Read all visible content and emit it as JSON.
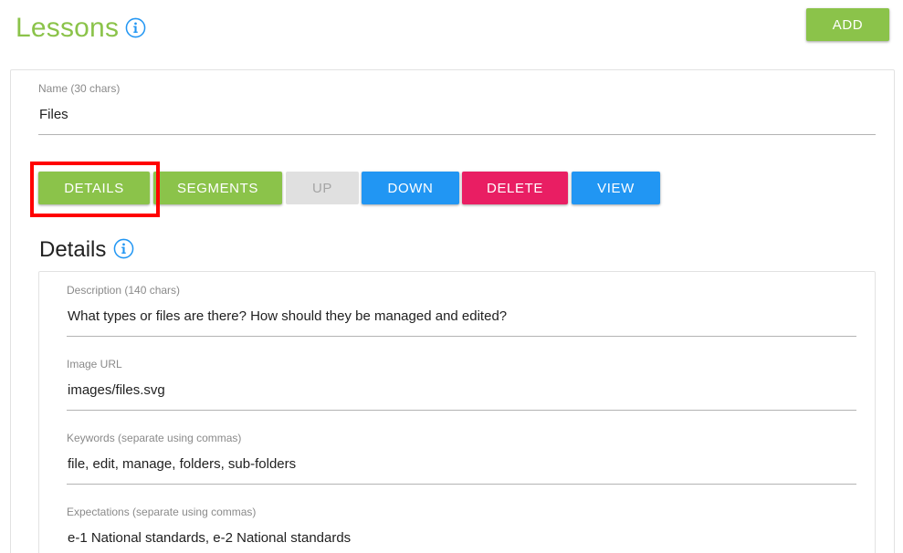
{
  "header": {
    "title": "Lessons",
    "add_label": "ADD"
  },
  "lesson": {
    "name_label": "Name (30 chars)",
    "name_value": "Files"
  },
  "actions": {
    "details": "DETAILS",
    "segments": "SEGMENTS",
    "up": "UP",
    "down": "DOWN",
    "delete": "DELETE",
    "view": "VIEW"
  },
  "details": {
    "title": "Details",
    "description_label": "Description (140 chars)",
    "description_value": "What types or files are there? How should they be managed and edited?",
    "image_url_label": "Image URL",
    "image_url_value": "images/files.svg",
    "keywords_label": "Keywords (separate using commas)",
    "keywords_value": "file, edit, manage, folders, sub-folders",
    "expectations_label": "Expectations (separate using commas)",
    "expectations_value": "e-1 National standards, e-2 National standards"
  },
  "colors": {
    "green": "#8bc34a",
    "blue": "#2196f3",
    "pink": "#e91e63",
    "disabled": "#e0e0e0",
    "highlight": "#ff0000"
  },
  "icons": {
    "info": "info-circle-icon"
  }
}
